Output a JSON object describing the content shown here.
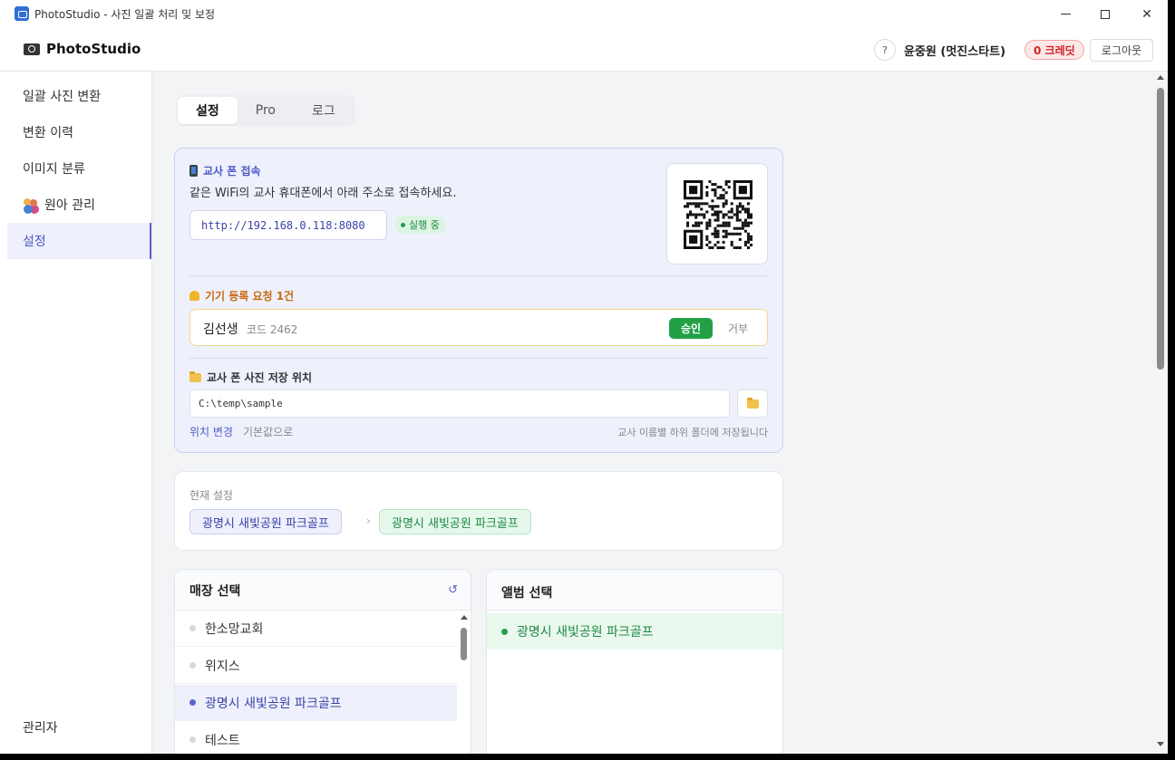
{
  "window": {
    "title": "PhotoStudio - 사진 일괄 처리 및 보정"
  },
  "header": {
    "brand": "PhotoStudio",
    "help_label": "?",
    "username": "윤중원 (멋진스타트)",
    "credits": "0 크레딧",
    "logout_label": "로그아웃"
  },
  "sidebar": {
    "items": [
      {
        "label": "일괄 사진 변환",
        "active": false
      },
      {
        "label": "변환 이력",
        "active": false
      },
      {
        "label": "이미지 분류",
        "active": false
      },
      {
        "label": "원아 관리",
        "active": false
      },
      {
        "label": "설정",
        "active": true
      }
    ],
    "admin_label": "관리자"
  },
  "tabs": [
    {
      "label": "설정",
      "active": true
    },
    {
      "label": "Pro",
      "active": false
    },
    {
      "label": "로그",
      "active": false
    }
  ],
  "phone_access": {
    "title": "교사 폰 접속",
    "description": "같은 WiFi의 교사 휴대폰에서 아래 주소로 접속하세요.",
    "url": "http://192.168.0.118:8080",
    "status": "실행 중"
  },
  "device_request": {
    "title": "기기 등록 요청 1건",
    "name": "김선생",
    "code": "코드 2462",
    "approve_label": "승인",
    "reject_label": "거부"
  },
  "storage": {
    "title": "교사 폰 사진 저장 위치",
    "path": "C:\\temp\\sample",
    "change_label": "위치 변경",
    "default_label": "기본값으로",
    "note": "교사 이름별 하위 폴더에 저장됩니다"
  },
  "current_settings": {
    "label": "현재 설정",
    "store": "광명시 새빛공원 파크골프",
    "separator": "›",
    "album": "광명시 새빛공원 파크골프"
  },
  "store_panel": {
    "title": "매장 선택",
    "refresh_icon": "↺",
    "items": [
      {
        "label": "한소망교회",
        "selected": false
      },
      {
        "label": "위지스",
        "selected": false
      },
      {
        "label": "광명시 새빛공원 파크골프",
        "selected": true
      },
      {
        "label": "테스트",
        "selected": false
      }
    ]
  },
  "album_panel": {
    "title": "앨범 선택",
    "items": [
      {
        "label": "광명시 새빛공원 파크골프",
        "selected": true
      }
    ]
  },
  "colors": {
    "accent": "#5b63d3",
    "success": "#22a046",
    "danger": "#d32525",
    "warning": "#c86a10"
  }
}
